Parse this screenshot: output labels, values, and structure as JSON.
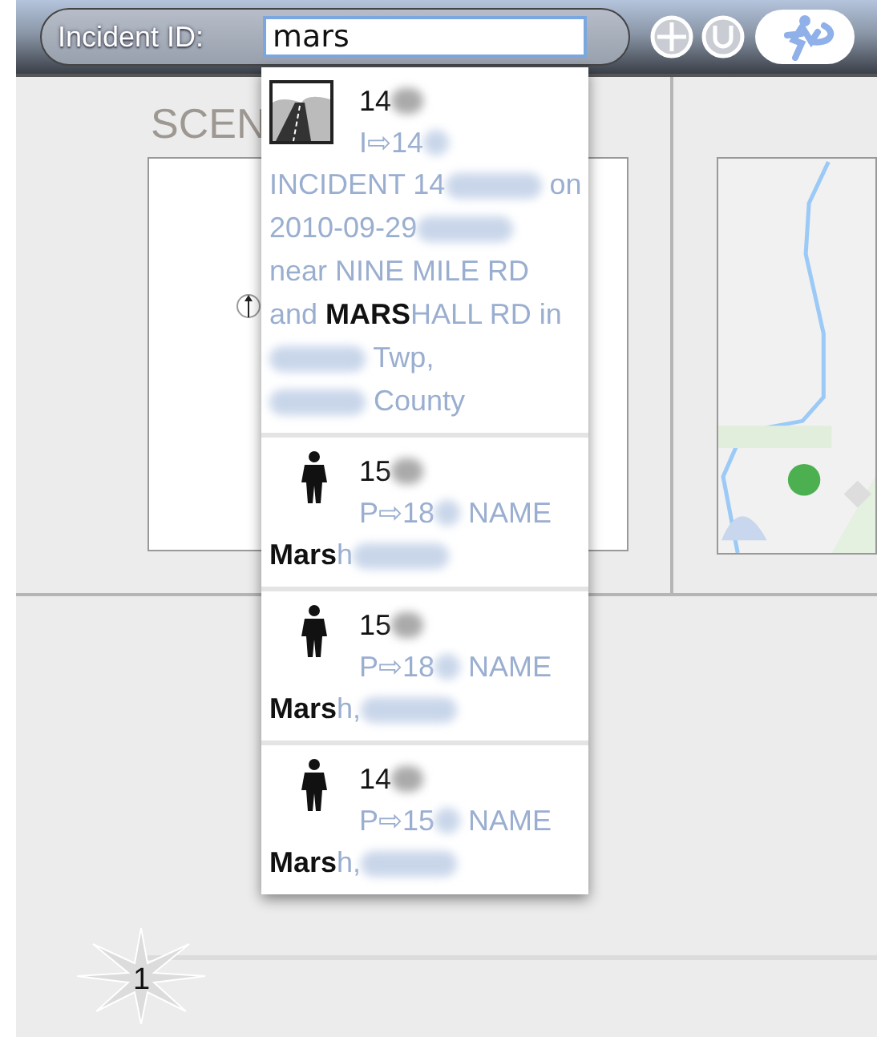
{
  "search": {
    "label": "Incident ID:",
    "value": "mars"
  },
  "left_panel": {
    "title": "SCEN"
  },
  "results": [
    {
      "kind": "incident",
      "id": "14",
      "link": "I⇨14",
      "lines": [
        {
          "segments": [
            {
              "text": "INCIDENT 14"
            },
            {
              "kind": "blur"
            },
            {
              "text": " on"
            }
          ]
        },
        {
          "segments": [
            {
              "text": "2010-09-29"
            },
            {
              "kind": "blur"
            }
          ]
        },
        {
          "segments": [
            {
              "text": "near NINE MILE RD"
            }
          ]
        },
        {
          "segments": [
            {
              "text": "and **MARS**HALL RD in"
            }
          ]
        },
        {
          "segments": [
            {
              "kind": "blur"
            },
            {
              "text": " Twp,"
            }
          ]
        },
        {
          "segments": [
            {
              "kind": "blur"
            },
            {
              "text": " County"
            }
          ]
        }
      ]
    },
    {
      "kind": "person",
      "id": "15",
      "link": "P⇨18",
      "link_suffix": " NAME",
      "lines": [
        {
          "segments": [
            {
              "text": "**Mars**h"
            },
            {
              "kind": "blur"
            }
          ]
        }
      ]
    },
    {
      "kind": "person",
      "id": "15",
      "link": "P⇨18",
      "link_suffix": " NAME",
      "lines": [
        {
          "segments": [
            {
              "text": "**Mars**h,"
            },
            {
              "kind": "blur"
            }
          ]
        }
      ]
    },
    {
      "kind": "person",
      "id": "14",
      "link": "P⇨15",
      "link_suffix": " NAME",
      "lines": [
        {
          "segments": [
            {
              "text": "**Mars**h,"
            },
            {
              "kind": "blur"
            }
          ]
        }
      ]
    }
  ],
  "page_badge": "1"
}
